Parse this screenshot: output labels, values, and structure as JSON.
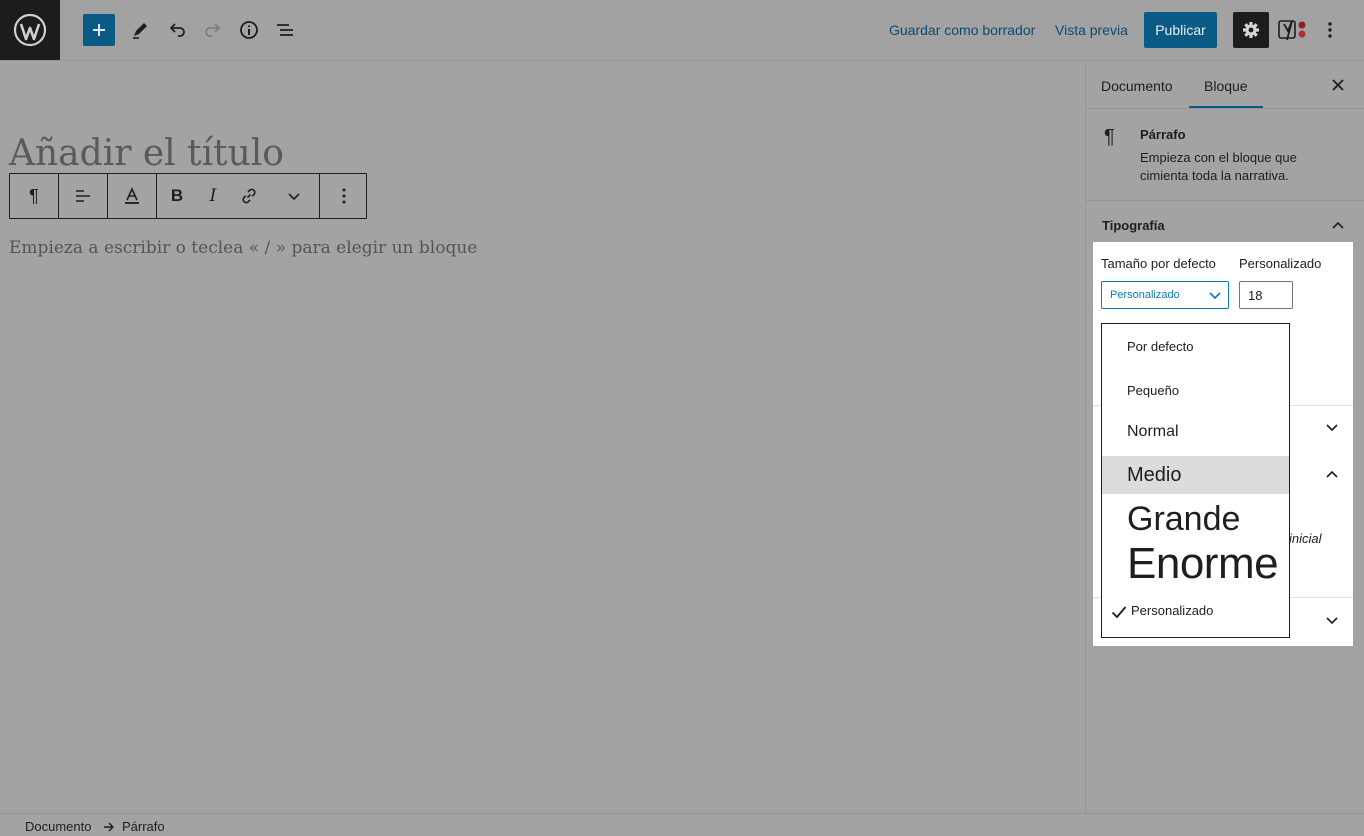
{
  "topbar": {
    "save_draft": "Guardar como borrador",
    "preview": "Vista previa",
    "publish": "Publicar",
    "icons": [
      "wordpress-logo-icon",
      "plus-icon",
      "pencil-icon",
      "undo-icon",
      "redo-icon",
      "info-icon",
      "list-view-icon",
      "gear-icon",
      "yoast-icon",
      "more-vertical-icon"
    ]
  },
  "editor": {
    "title_placeholder": "Añadir el título",
    "paragraph_placeholder": "Empieza a escribir o teclea « / » para elegir un bloque"
  },
  "sidebar": {
    "tabs": [
      {
        "label": "Documento"
      },
      {
        "label": "Bloque",
        "active": true
      }
    ],
    "block_card": {
      "title": "Párrafo",
      "description": "Empieza con el bloque que cimienta toda la narrativa."
    },
    "typography": {
      "title": "Tipografía",
      "default_size_label": "Tamaño por defecto",
      "custom_label": "Personalizado",
      "select_value": "Personalizado",
      "custom_value": "18"
    },
    "behind_text": "inicial"
  },
  "dropdown": {
    "options": [
      {
        "label": "Por defecto"
      },
      {
        "label": "Pequeño"
      },
      {
        "label": "Normal"
      },
      {
        "label": "Medio",
        "highlighted": true
      },
      {
        "label": "Grande"
      },
      {
        "label": "Enorme"
      },
      {
        "label": "Personalizado",
        "selected": true
      }
    ]
  },
  "breadcrumb": {
    "items": [
      "Documento",
      "Párrafo"
    ]
  },
  "colors": {
    "accent": "#0a5a86",
    "overlay": "#a3a3a3",
    "dark": "#1c1c1c"
  }
}
